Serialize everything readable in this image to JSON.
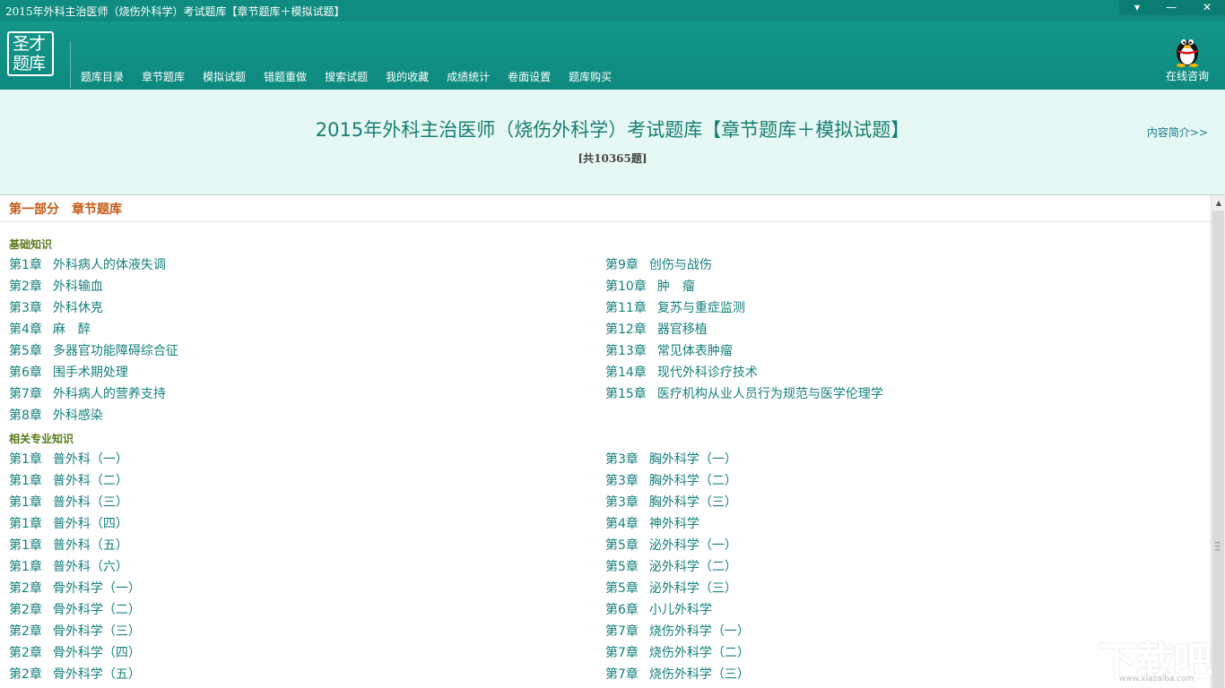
{
  "window": {
    "title": "2015年外科主治医师（烧伤外科学）考试题库【章节题库＋模拟试题】",
    "controls": [
      "▾",
      "—",
      "✕"
    ]
  },
  "logo": {
    "line1": "圣才",
    "line2": "题库"
  },
  "nav": {
    "items": [
      {
        "label": "题库目录"
      },
      {
        "label": "章节题库"
      },
      {
        "label": "模拟试题"
      },
      {
        "label": "错题重做"
      },
      {
        "label": "搜索试题"
      },
      {
        "label": "我的收藏"
      },
      {
        "label": "成绩统计"
      },
      {
        "label": "卷面设置"
      },
      {
        "label": "题库购买"
      }
    ],
    "consult_label": "在线咨询"
  },
  "header": {
    "title": "2015年外科主治医师（烧伤外科学）考试题库【章节题库＋模拟试题】",
    "count": "[共10365题]",
    "intro_link": "内容简介>>"
  },
  "content": {
    "part_title": "第一部分　章节题库",
    "sections": [
      {
        "title": "基础知识",
        "left": [
          {
            "num": "第1章",
            "name": "外科病人的体液失调"
          },
          {
            "num": "第2章",
            "name": "外科输血"
          },
          {
            "num": "第3章",
            "name": "外科休克"
          },
          {
            "num": "第4章",
            "name": "麻　醉"
          },
          {
            "num": "第5章",
            "name": "多器官功能障碍综合征"
          },
          {
            "num": "第6章",
            "name": "围手术期处理"
          },
          {
            "num": "第7章",
            "name": "外科病人的营养支持"
          },
          {
            "num": "第8章",
            "name": "外科感染"
          }
        ],
        "right": [
          {
            "num": "第9章",
            "name": "创伤与战伤"
          },
          {
            "num": "第10章",
            "name": "肿　瘤"
          },
          {
            "num": "第11章",
            "name": "复苏与重症监测"
          },
          {
            "num": "第12章",
            "name": "器官移植"
          },
          {
            "num": "第13章",
            "name": "常见体表肿瘤"
          },
          {
            "num": "第14章",
            "name": "现代外科诊疗技术"
          },
          {
            "num": "第15章",
            "name": "医疗机构从业人员行为规范与医学伦理学"
          }
        ]
      },
      {
        "title": "相关专业知识",
        "left": [
          {
            "num": "第1章",
            "name": "普外科（一）"
          },
          {
            "num": "第1章",
            "name": "普外科（二）"
          },
          {
            "num": "第1章",
            "name": "普外科（三）"
          },
          {
            "num": "第1章",
            "name": "普外科（四）"
          },
          {
            "num": "第1章",
            "name": "普外科（五）"
          },
          {
            "num": "第1章",
            "name": "普外科（六）"
          },
          {
            "num": "第2章",
            "name": "骨外科学（一）"
          },
          {
            "num": "第2章",
            "name": "骨外科学（二）"
          },
          {
            "num": "第2章",
            "name": "骨外科学（三）"
          },
          {
            "num": "第2章",
            "name": "骨外科学（四）"
          },
          {
            "num": "第2章",
            "name": "骨外科学（五）"
          }
        ],
        "right": [
          {
            "num": "第3章",
            "name": "胸外科学（一）"
          },
          {
            "num": "第3章",
            "name": "胸外科学（二）"
          },
          {
            "num": "第3章",
            "name": "胸外科学（三）"
          },
          {
            "num": "第4章",
            "name": "神外科学"
          },
          {
            "num": "第5章",
            "name": "泌外科学（一）"
          },
          {
            "num": "第5章",
            "name": "泌外科学（二）"
          },
          {
            "num": "第5章",
            "name": "泌外科学（三）"
          },
          {
            "num": "第6章",
            "name": "小儿外科学"
          },
          {
            "num": "第7章",
            "name": "烧伤外科学（一）"
          },
          {
            "num": "第7章",
            "name": "烧伤外科学（二）"
          },
          {
            "num": "第7章",
            "name": "烧伤外科学（三）"
          }
        ]
      }
    ]
  },
  "watermark": {
    "main": "下载吧",
    "sub": "www.xiazaiba.com"
  },
  "colors": {
    "titlebar": "#0f8b80",
    "navband": "#14968a",
    "header_bg": "#e6f8f3",
    "title_text": "#197d73",
    "chapter_link": "#15807a",
    "part_title": "#c45a16",
    "section_title": "#5a7a1a"
  }
}
